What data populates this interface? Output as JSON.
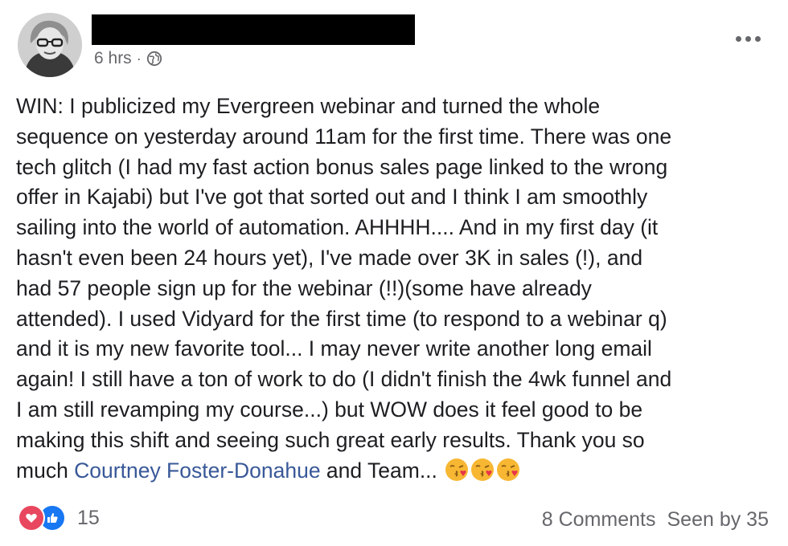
{
  "post": {
    "timestamp": "6 hrs",
    "separator": "·",
    "privacy_icon": "globe-icon",
    "more_icon": "more-options-icon",
    "body_before_mention": "WIN:  I publicized my Evergreen webinar and turned the whole\nsequence on yesterday around 11am for the first time.  There was one\ntech glitch (I had my fast action bonus sales page linked to the wrong\noffer in Kajabi) but I've got that sorted out and I think I am smoothly\nsailing into the world of automation.  AHHHH....  And in my first day (it\nhasn't even been 24 hours yet), I've made over 3K in sales (!), and\nhad 57 people sign up for the webinar (!!)(some have already\nattended).  I used Vidyard for the first time (to respond to a webinar q)\nand it is my new favorite tool... I may never write another long email\nagain!  I still have a ton of work to do (I didn't finish the 4wk funnel and\nI am still revamping my course...) but WOW does it feel good to be\nmaking this shift and seeing such great early results.  Thank you so\nmuch ",
    "mention": "Courtney Foster-Donahue",
    "body_after_mention": " and Team... ",
    "emojis": [
      "kiss-emoji",
      "kiss-emoji",
      "kiss-emoji"
    ]
  },
  "footer": {
    "reaction_icons": [
      "love-icon",
      "like-icon"
    ],
    "reaction_count": "15",
    "comments": "8 Comments",
    "seen_by": "Seen by 35"
  },
  "colors": {
    "mention": "#385898",
    "meta_text": "#65676b",
    "love": "#e8475f",
    "like": "#1877f2"
  }
}
